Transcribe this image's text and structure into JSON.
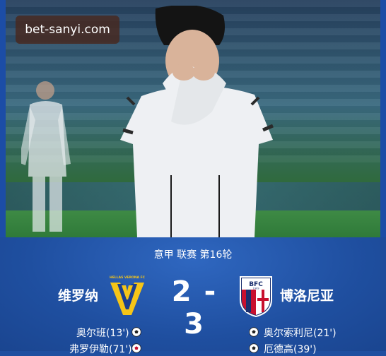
{
  "watermark": "bet-sanyi.com",
  "match": {
    "competition": "意甲  联赛  第16轮",
    "home_team": "维罗纳",
    "away_team": "博洛尼亚",
    "home_score": "2",
    "separator": "-",
    "away_score": "3",
    "home_logo_text": "HELLAS VERONA FC",
    "away_logo_text": "BFC 1909",
    "home_scorers": [
      "奥尔班(13')",
      "弗罗伊勒(71')"
    ],
    "away_scorers": [
      "奥尔索利尼(21')",
      "厄德高(39')"
    ]
  },
  "colors": {
    "panel": "#1f4fa0",
    "verona_yellow": "#f5c518",
    "verona_blue": "#1b3f8f",
    "bologna_red": "#c8102e",
    "bologna_blue": "#1a2f6e"
  }
}
